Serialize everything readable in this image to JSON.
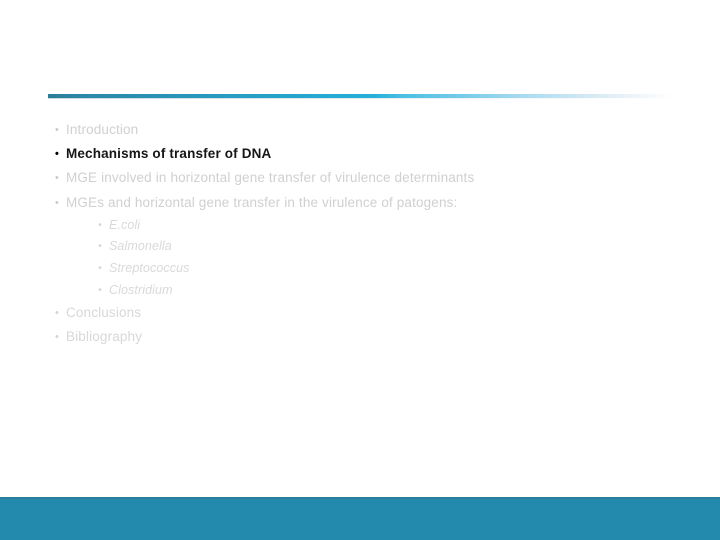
{
  "slide": {
    "background_color": "#ffffff",
    "divider": {
      "accent_start_color": "#2e7e99",
      "accent_mid_color": "#24b0da",
      "accent_end_color": "#ffffff"
    },
    "footer_band": {
      "color": "#2389ad",
      "edge_color": "#2c7e9c"
    },
    "outline": {
      "bullet_glyph": "•",
      "items": [
        {
          "label": "Introduction",
          "state": "inactive",
          "color": "#d0d0d0",
          "children": []
        },
        {
          "label": "Mechanisms of transfer of DNA",
          "state": "active",
          "color": "#161616",
          "children": []
        },
        {
          "label": "MGE involved in horizontal gene transfer of virulence determinants",
          "state": "inactive",
          "color": "#d0d0d0",
          "children": []
        },
        {
          "label": "MGEs and horizontal gene transfer in the virulence of patogens:",
          "state": "inactive",
          "color": "#d0d0d0",
          "children": [
            {
              "label": "E.coli",
              "state": "inactive",
              "color": "#d9d9d9"
            },
            {
              "label": "Salmonella",
              "state": "inactive",
              "color": "#d9d9d9"
            },
            {
              "label": "Streptococcus",
              "state": "inactive",
              "color": "#d9d9d9"
            },
            {
              "label": "Clostridium",
              "state": "inactive",
              "color": "#d9d9d9"
            }
          ]
        },
        {
          "label": "Conclusions",
          "state": "inactive",
          "color": "#d8d8d8",
          "children": []
        },
        {
          "label": "Bibliography",
          "state": "inactive",
          "color": "#d8d8d8",
          "children": []
        }
      ]
    }
  }
}
